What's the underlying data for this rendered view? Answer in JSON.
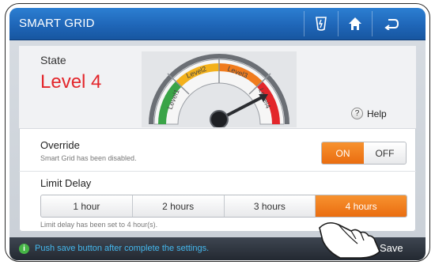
{
  "header": {
    "title": "SMART GRID",
    "icons": [
      "grid-status-icon",
      "home-icon",
      "back-icon"
    ]
  },
  "state": {
    "label": "State",
    "value": "Level 4",
    "value_color": "#e3262b",
    "gauge": {
      "levels": [
        "Level1",
        "Level2",
        "Level3",
        "Level4"
      ],
      "current_level": 4,
      "colors": [
        "#3aa447",
        "#f3b11b",
        "#f07b1d",
        "#e3262b"
      ]
    },
    "help_label": "Help"
  },
  "override": {
    "label": "Override",
    "status": "Smart Grid has been disabled.",
    "on_label": "ON",
    "off_label": "OFF",
    "selected": "ON"
  },
  "limit_delay": {
    "label": "Limit Delay",
    "options": [
      "1 hour",
      "2 hours",
      "3 hours",
      "4 hours"
    ],
    "selected": "4 hours",
    "status": "Limit delay has been set to 4 hour(s)."
  },
  "footer": {
    "message": "Push save button after complete the settings.",
    "save_label": "Save"
  },
  "accent_color": "#ef7d1a"
}
